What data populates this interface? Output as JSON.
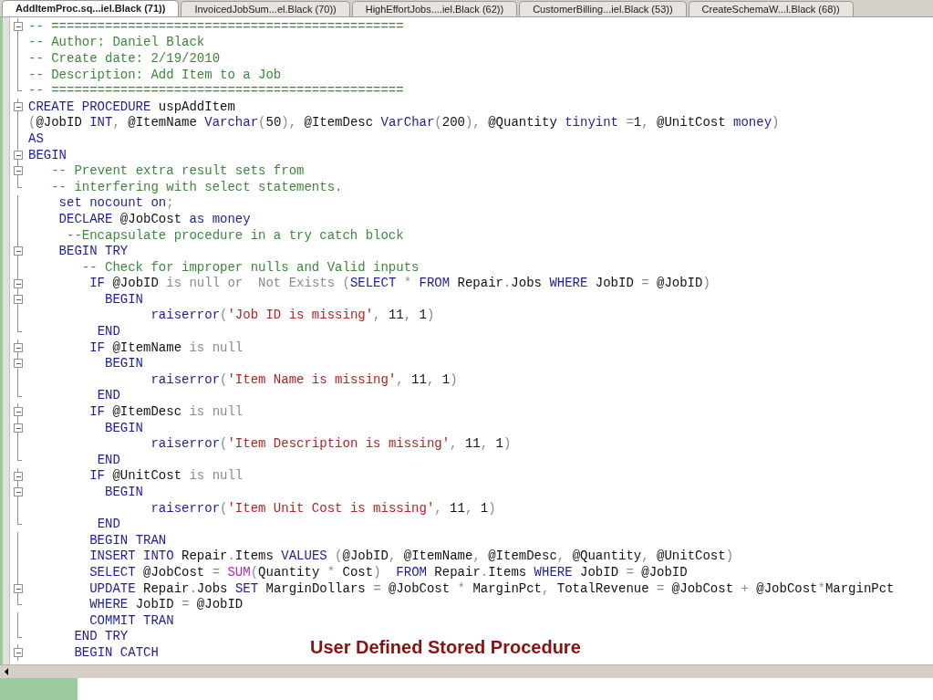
{
  "tabs": [
    {
      "label": "AddItemProc.sq...iel.Black (71))",
      "selected": true
    },
    {
      "label": "InvoicedJobSum...el.Black (70))",
      "selected": false
    },
    {
      "label": "HighEffortJobs....iel.Black (62))",
      "selected": false
    },
    {
      "label": "CustomerBilling...iel.Black (53))",
      "selected": false
    },
    {
      "label": "CreateSchemaW...l.Black (68))",
      "selected": false
    }
  ],
  "code_lines": [
    {
      "kind": "start",
      "tokens": [
        {
          "kind": "comment",
          "text": "-- =============================================="
        }
      ]
    },
    {
      "kind": "body",
      "tokens": [
        {
          "kind": "comment",
          "text": "-- Author: Daniel Black"
        }
      ]
    },
    {
      "kind": "body",
      "tokens": [
        {
          "kind": "comment",
          "text": "-- Create date: 2/19/2010"
        }
      ]
    },
    {
      "kind": "body",
      "tokens": [
        {
          "kind": "comment",
          "text": "-- Description: Add Item to a Job"
        }
      ]
    },
    {
      "kind": "end",
      "tokens": [
        {
          "kind": "comment",
          "text": "-- =============================================="
        }
      ]
    },
    {
      "kind": "start",
      "tokens": [
        {
          "kind": "keyword",
          "text": "CREATE PROCEDURE"
        },
        {
          "kind": "plain",
          "text": " uspAddItem"
        }
      ]
    },
    {
      "kind": "body",
      "tokens": [
        {
          "kind": "operator",
          "text": "("
        },
        {
          "kind": "plain",
          "text": "@JobID "
        },
        {
          "kind": "keyword",
          "text": "INT"
        },
        {
          "kind": "operator",
          "text": ", "
        },
        {
          "kind": "plain",
          "text": "@ItemName "
        },
        {
          "kind": "keyword",
          "text": "Varchar"
        },
        {
          "kind": "operator",
          "text": "("
        },
        {
          "kind": "plain",
          "text": "50"
        },
        {
          "kind": "operator",
          "text": "), "
        },
        {
          "kind": "plain",
          "text": "@ItemDesc "
        },
        {
          "kind": "keyword",
          "text": "VarChar"
        },
        {
          "kind": "operator",
          "text": "("
        },
        {
          "kind": "plain",
          "text": "200"
        },
        {
          "kind": "operator",
          "text": "), "
        },
        {
          "kind": "plain",
          "text": "@Quantity "
        },
        {
          "kind": "keyword",
          "text": "tinyint"
        },
        {
          "kind": "operator",
          "text": " ="
        },
        {
          "kind": "plain",
          "text": "1"
        },
        {
          "kind": "operator",
          "text": ", "
        },
        {
          "kind": "plain",
          "text": "@UnitCost "
        },
        {
          "kind": "keyword",
          "text": "money"
        },
        {
          "kind": "operator",
          "text": ")"
        }
      ]
    },
    {
      "kind": "body",
      "tokens": [
        {
          "kind": "keyword",
          "text": "AS"
        }
      ]
    },
    {
      "kind": "start",
      "tokens": [
        {
          "kind": "keyword",
          "text": "BEGIN"
        }
      ]
    },
    {
      "kind": "start",
      "tokens": [
        {
          "kind": "comment",
          "text": "   -- Prevent extra result sets from"
        }
      ]
    },
    {
      "kind": "end",
      "tokens": [
        {
          "kind": "comment",
          "text": "   -- interfering with select statements."
        }
      ]
    },
    {
      "kind": "body",
      "tokens": [
        {
          "kind": "keyword",
          "text": "    set nocount on"
        },
        {
          "kind": "operator",
          "text": ";"
        }
      ]
    },
    {
      "kind": "body",
      "tokens": [
        {
          "kind": "keyword",
          "text": "    DECLARE"
        },
        {
          "kind": "plain",
          "text": " @JobCost "
        },
        {
          "kind": "keyword",
          "text": "as money"
        }
      ]
    },
    {
      "kind": "body",
      "tokens": [
        {
          "kind": "comment",
          "text": "     --Encapsulate procedure in a try catch block"
        }
      ]
    },
    {
      "kind": "start",
      "tokens": [
        {
          "kind": "keyword",
          "text": "    BEGIN TRY"
        }
      ]
    },
    {
      "kind": "body",
      "tokens": [
        {
          "kind": "comment",
          "text": "       -- Check for improper nulls and Valid inputs"
        }
      ]
    },
    {
      "kind": "start",
      "tokens": [
        {
          "kind": "keyword",
          "text": "        IF"
        },
        {
          "kind": "plain",
          "text": " @JobID "
        },
        {
          "kind": "operator",
          "text": "is null or  Not Exists ("
        },
        {
          "kind": "keyword",
          "text": "SELECT"
        },
        {
          "kind": "operator",
          "text": " * "
        },
        {
          "kind": "keyword",
          "text": "FROM"
        },
        {
          "kind": "plain",
          "text": " Repair"
        },
        {
          "kind": "operator",
          "text": "."
        },
        {
          "kind": "plain",
          "text": "Jobs "
        },
        {
          "kind": "keyword",
          "text": "WHERE"
        },
        {
          "kind": "plain",
          "text": " JobID "
        },
        {
          "kind": "operator",
          "text": "= "
        },
        {
          "kind": "plain",
          "text": "@JobID"
        },
        {
          "kind": "operator",
          "text": ")"
        }
      ]
    },
    {
      "kind": "start",
      "tokens": [
        {
          "kind": "keyword",
          "text": "          BEGIN"
        }
      ]
    },
    {
      "kind": "body",
      "tokens": [
        {
          "kind": "keyword",
          "text": "                raiserror"
        },
        {
          "kind": "operator",
          "text": "("
        },
        {
          "kind": "string",
          "text": "'Job ID is missing'"
        },
        {
          "kind": "operator",
          "text": ", "
        },
        {
          "kind": "plain",
          "text": "11"
        },
        {
          "kind": "operator",
          "text": ", "
        },
        {
          "kind": "plain",
          "text": "1"
        },
        {
          "kind": "operator",
          "text": ")"
        }
      ]
    },
    {
      "kind": "end",
      "tokens": [
        {
          "kind": "keyword",
          "text": "         END"
        }
      ]
    },
    {
      "kind": "start",
      "tokens": [
        {
          "kind": "keyword",
          "text": "        IF"
        },
        {
          "kind": "plain",
          "text": " @ItemName "
        },
        {
          "kind": "operator",
          "text": "is null"
        }
      ]
    },
    {
      "kind": "start",
      "tokens": [
        {
          "kind": "keyword",
          "text": "          BEGIN"
        }
      ]
    },
    {
      "kind": "body",
      "tokens": [
        {
          "kind": "keyword",
          "text": "                raiserror"
        },
        {
          "kind": "operator",
          "text": "("
        },
        {
          "kind": "string",
          "text": "'Item Name is missing'"
        },
        {
          "kind": "operator",
          "text": ", "
        },
        {
          "kind": "plain",
          "text": "11"
        },
        {
          "kind": "operator",
          "text": ", "
        },
        {
          "kind": "plain",
          "text": "1"
        },
        {
          "kind": "operator",
          "text": ")"
        }
      ]
    },
    {
      "kind": "end",
      "tokens": [
        {
          "kind": "keyword",
          "text": "         END"
        }
      ]
    },
    {
      "kind": "start",
      "tokens": [
        {
          "kind": "keyword",
          "text": "        IF"
        },
        {
          "kind": "plain",
          "text": " @ItemDesc "
        },
        {
          "kind": "operator",
          "text": "is null"
        }
      ]
    },
    {
      "kind": "start",
      "tokens": [
        {
          "kind": "keyword",
          "text": "          BEGIN"
        }
      ]
    },
    {
      "kind": "body",
      "tokens": [
        {
          "kind": "keyword",
          "text": "                raiserror"
        },
        {
          "kind": "operator",
          "text": "("
        },
        {
          "kind": "string",
          "text": "'Item Description is missing'"
        },
        {
          "kind": "operator",
          "text": ", "
        },
        {
          "kind": "plain",
          "text": "11"
        },
        {
          "kind": "operator",
          "text": ", "
        },
        {
          "kind": "plain",
          "text": "1"
        },
        {
          "kind": "operator",
          "text": ")"
        }
      ]
    },
    {
      "kind": "end",
      "tokens": [
        {
          "kind": "keyword",
          "text": "         END"
        }
      ]
    },
    {
      "kind": "start",
      "tokens": [
        {
          "kind": "keyword",
          "text": "        IF"
        },
        {
          "kind": "plain",
          "text": " @UnitCost "
        },
        {
          "kind": "operator",
          "text": "is null"
        }
      ]
    },
    {
      "kind": "start",
      "tokens": [
        {
          "kind": "keyword",
          "text": "          BEGIN"
        }
      ]
    },
    {
      "kind": "body",
      "tokens": [
        {
          "kind": "keyword",
          "text": "                raiserror"
        },
        {
          "kind": "operator",
          "text": "("
        },
        {
          "kind": "string",
          "text": "'Item Unit Cost is missing'"
        },
        {
          "kind": "operator",
          "text": ", "
        },
        {
          "kind": "plain",
          "text": "11"
        },
        {
          "kind": "operator",
          "text": ", "
        },
        {
          "kind": "plain",
          "text": "1"
        },
        {
          "kind": "operator",
          "text": ")"
        }
      ]
    },
    {
      "kind": "end",
      "tokens": [
        {
          "kind": "keyword",
          "text": "         END"
        }
      ]
    },
    {
      "kind": "body",
      "tokens": [
        {
          "kind": "keyword",
          "text": "        BEGIN TRAN"
        }
      ]
    },
    {
      "kind": "body",
      "tokens": [
        {
          "kind": "keyword",
          "text": "        INSERT INTO"
        },
        {
          "kind": "plain",
          "text": " Repair"
        },
        {
          "kind": "operator",
          "text": "."
        },
        {
          "kind": "plain",
          "text": "Items "
        },
        {
          "kind": "keyword",
          "text": "VALUES"
        },
        {
          "kind": "operator",
          "text": " ("
        },
        {
          "kind": "plain",
          "text": "@JobID"
        },
        {
          "kind": "operator",
          "text": ", "
        },
        {
          "kind": "plain",
          "text": "@ItemName"
        },
        {
          "kind": "operator",
          "text": ", "
        },
        {
          "kind": "plain",
          "text": "@ItemDesc"
        },
        {
          "kind": "operator",
          "text": ", "
        },
        {
          "kind": "plain",
          "text": "@Quantity"
        },
        {
          "kind": "operator",
          "text": ", "
        },
        {
          "kind": "plain",
          "text": "@UnitCost"
        },
        {
          "kind": "operator",
          "text": ")"
        }
      ]
    },
    {
      "kind": "body",
      "tokens": [
        {
          "kind": "keyword",
          "text": "        SELECT"
        },
        {
          "kind": "plain",
          "text": " @JobCost "
        },
        {
          "kind": "operator",
          "text": "= "
        },
        {
          "kind": "function",
          "text": "SUM"
        },
        {
          "kind": "operator",
          "text": "("
        },
        {
          "kind": "plain",
          "text": "Quantity "
        },
        {
          "kind": "operator",
          "text": "* "
        },
        {
          "kind": "plain",
          "text": "Cost"
        },
        {
          "kind": "operator",
          "text": ")  "
        },
        {
          "kind": "keyword",
          "text": "FROM"
        },
        {
          "kind": "plain",
          "text": " Repair"
        },
        {
          "kind": "operator",
          "text": "."
        },
        {
          "kind": "plain",
          "text": "Items "
        },
        {
          "kind": "keyword",
          "text": "WHERE"
        },
        {
          "kind": "plain",
          "text": " JobID "
        },
        {
          "kind": "operator",
          "text": "= "
        },
        {
          "kind": "plain",
          "text": "@JobID"
        }
      ]
    },
    {
      "kind": "start",
      "tokens": [
        {
          "kind": "keyword",
          "text": "        UPDATE"
        },
        {
          "kind": "plain",
          "text": " Repair"
        },
        {
          "kind": "operator",
          "text": "."
        },
        {
          "kind": "plain",
          "text": "Jobs "
        },
        {
          "kind": "keyword",
          "text": "SET"
        },
        {
          "kind": "plain",
          "text": " MarginDollars "
        },
        {
          "kind": "operator",
          "text": "= "
        },
        {
          "kind": "plain",
          "text": "@JobCost "
        },
        {
          "kind": "operator",
          "text": "* "
        },
        {
          "kind": "plain",
          "text": "MarginPct"
        },
        {
          "kind": "operator",
          "text": ", "
        },
        {
          "kind": "plain",
          "text": "TotalRevenue "
        },
        {
          "kind": "operator",
          "text": "= "
        },
        {
          "kind": "plain",
          "text": "@JobCost "
        },
        {
          "kind": "operator",
          "text": "+ "
        },
        {
          "kind": "plain",
          "text": "@JobCost"
        },
        {
          "kind": "operator",
          "text": "*"
        },
        {
          "kind": "plain",
          "text": "MarginPct"
        }
      ]
    },
    {
      "kind": "end",
      "tokens": [
        {
          "kind": "keyword",
          "text": "        WHERE"
        },
        {
          "kind": "plain",
          "text": " JobID "
        },
        {
          "kind": "operator",
          "text": "= "
        },
        {
          "kind": "plain",
          "text": "@JobID"
        }
      ]
    },
    {
      "kind": "body",
      "tokens": [
        {
          "kind": "keyword",
          "text": "        COMMIT TRAN"
        }
      ]
    },
    {
      "kind": "end",
      "tokens": [
        {
          "kind": "keyword",
          "text": "      END TRY"
        }
      ]
    },
    {
      "kind": "start",
      "tokens": [
        {
          "kind": "keyword",
          "text": "      BEGIN CATCH"
        }
      ]
    }
  ],
  "caption": "User Defined Stored Procedure"
}
